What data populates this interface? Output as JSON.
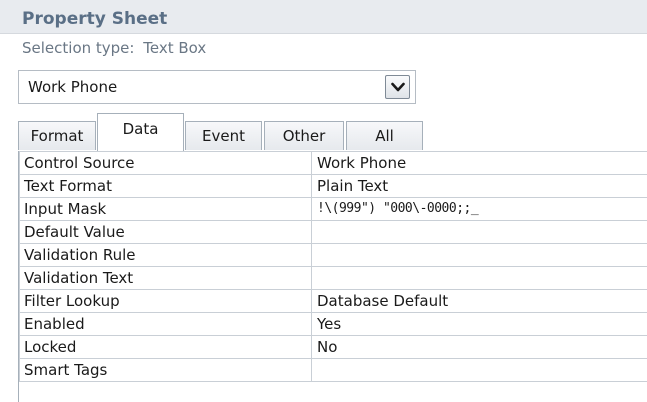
{
  "header": {
    "title": "Property Sheet",
    "selection_label": "Selection type:",
    "selection_type": "Text Box"
  },
  "combo": {
    "value": "Work Phone",
    "button_icon": "chevron-down-icon"
  },
  "tabs": [
    {
      "label": "Format",
      "active": false
    },
    {
      "label": "Data",
      "active": true
    },
    {
      "label": "Event",
      "active": false
    },
    {
      "label": "Other",
      "active": false
    },
    {
      "label": "All",
      "active": false
    }
  ],
  "properties": [
    {
      "name": "Control Source",
      "value": "Work Phone"
    },
    {
      "name": "Text Format",
      "value": "Plain Text"
    },
    {
      "name": "Input Mask",
      "value": "!\\(999\") \"000\\-0000;;_"
    },
    {
      "name": "Default Value",
      "value": ""
    },
    {
      "name": "Validation Rule",
      "value": ""
    },
    {
      "name": "Validation Text",
      "value": ""
    },
    {
      "name": "Filter Lookup",
      "value": "Database Default"
    },
    {
      "name": "Enabled",
      "value": "Yes"
    },
    {
      "name": "Locked",
      "value": "No"
    },
    {
      "name": "Smart Tags",
      "value": ""
    }
  ],
  "colors": {
    "title": "#5a6f86",
    "header_bg": "#e8ebef",
    "border": "#a6b0ba"
  }
}
